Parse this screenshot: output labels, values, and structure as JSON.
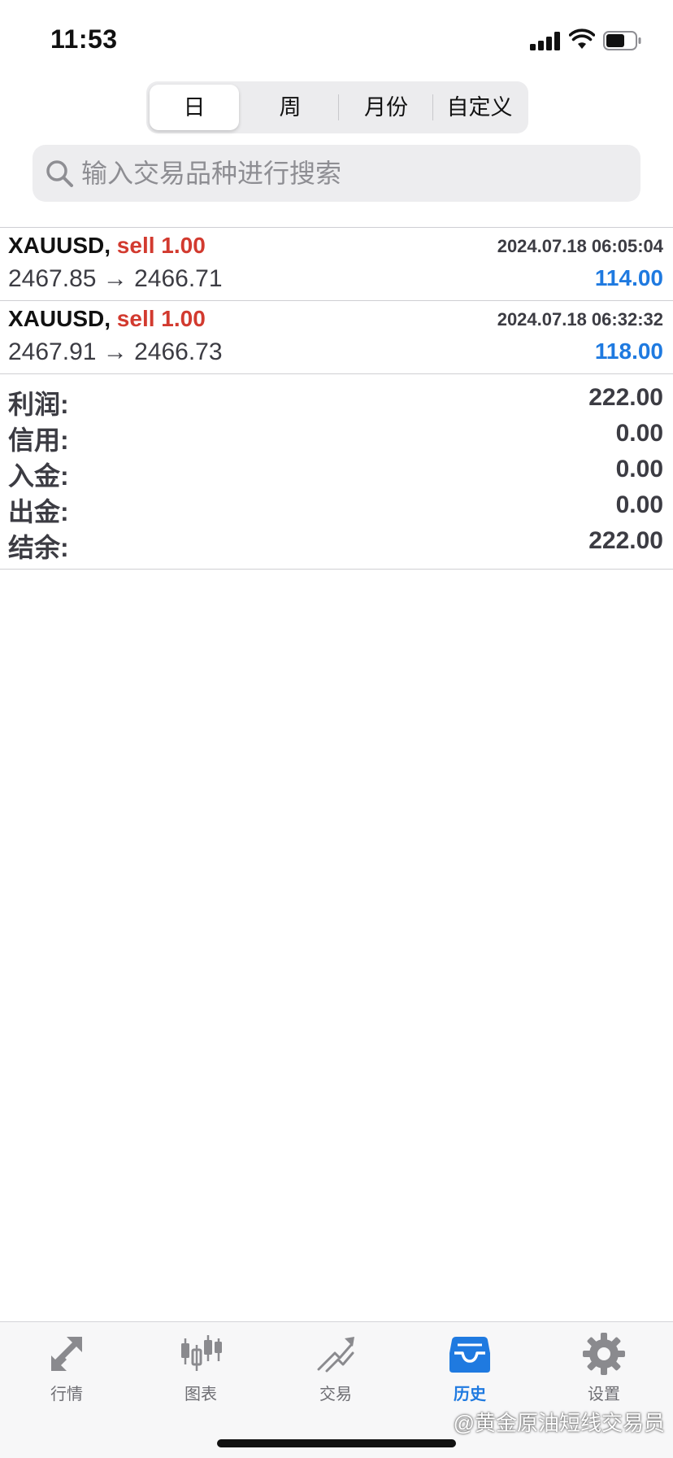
{
  "status_bar": {
    "time": "11:53"
  },
  "period_tabs": [
    {
      "label": "日",
      "active": true
    },
    {
      "label": "周",
      "active": false
    },
    {
      "label": "月份",
      "active": false
    },
    {
      "label": "自定义",
      "active": false
    }
  ],
  "search": {
    "placeholder": "输入交易品种进行搜索",
    "value": ""
  },
  "deals": [
    {
      "symbol": "XAUUSD,",
      "side": "sell 1.00",
      "time": "2024.07.18 06:05:04",
      "prices": "2467.85 → 2466.71",
      "profit": "114.00"
    },
    {
      "symbol": "XAUUSD,",
      "side": "sell 1.00",
      "time": "2024.07.18 06:32:32",
      "prices": "2467.91 → 2466.73",
      "profit": "118.00"
    }
  ],
  "summary": [
    {
      "label": "利润:",
      "value": "222.00"
    },
    {
      "label": "信用:",
      "value": "0.00"
    },
    {
      "label": "入金:",
      "value": "0.00"
    },
    {
      "label": "出金:",
      "value": "0.00"
    },
    {
      "label": "结余:",
      "value": "222.00"
    }
  ],
  "tab_bar": [
    {
      "label": "行情",
      "icon": "quotes-arrows-icon",
      "active": false
    },
    {
      "label": "图表",
      "icon": "candlestick-chart-icon",
      "active": false
    },
    {
      "label": "交易",
      "icon": "trade-trend-icon",
      "active": false
    },
    {
      "label": "历史",
      "icon": "history-inbox-icon",
      "active": true
    },
    {
      "label": "设置",
      "icon": "gear-icon",
      "active": false
    }
  ],
  "watermark": "@黄金原油短线交易员",
  "colors": {
    "sell": "#d23a2f",
    "profit": "#1f7ae0",
    "active_tab": "#1f7ae0",
    "inactive_icon": "#8a8a8e"
  }
}
